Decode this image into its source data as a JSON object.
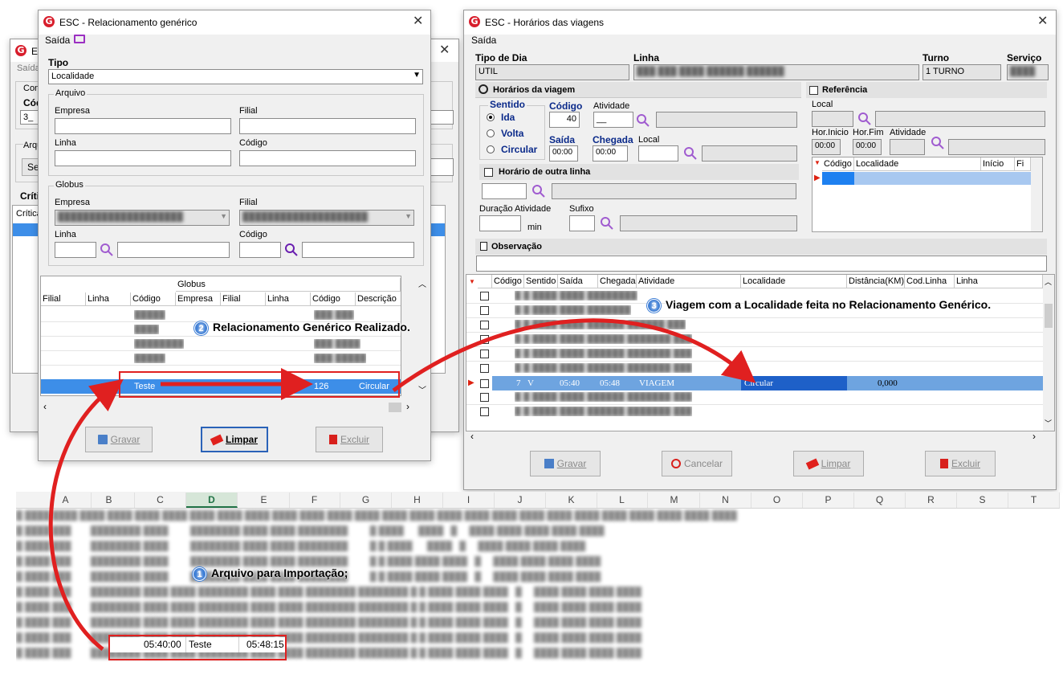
{
  "back_window": {
    "title_partial": "ES",
    "menu_partial": "Saída",
    "labels": [
      "Con",
      "Cód",
      "Arqu",
      "Crític"
    ],
    "code_value": "3_",
    "button_partial": "Se",
    "grid_header": "Crítica"
  },
  "rel_window": {
    "title": "ESC - Relacionamento genérico",
    "menu": "Saída",
    "tipo_label": "Tipo",
    "tipo_value": "Localidade",
    "arquivo": {
      "group_label": "Arquivo",
      "empresa_label": "Empresa",
      "filial_label": "Filial",
      "linha_label": "Linha",
      "codigo_label": "Código"
    },
    "globus": {
      "group_label": "Globus",
      "empresa_label": "Empresa",
      "filial_label": "Filial",
      "linha_label": "Linha",
      "codigo_label": "Código"
    },
    "grid": {
      "group_header": "Globus",
      "columns": [
        "Filial",
        "Linha",
        "Código",
        "Empresa",
        "Filial",
        "Linha",
        "Código",
        "Descrição"
      ],
      "selected_row": {
        "codigo": "Teste",
        "codigo_globus": "126",
        "descricao": "Circular"
      }
    },
    "buttons": {
      "gravar": "Gravar",
      "limpar": "Limpar",
      "excluir": "Excluir"
    }
  },
  "hor_window": {
    "title": "ESC - Horários das viagens",
    "menu": "Saída",
    "tipo_dia_label": "Tipo de Dia",
    "tipo_dia_value": "UTIL",
    "linha_label": "Linha",
    "turno_label": "Turno",
    "turno_value": "1 TURNO",
    "servico_label": "Serviço",
    "horarios_panel": "Horários da viagem",
    "sentido_label": "Sentido",
    "sentido_options": [
      "Ida",
      "Volta",
      "Circular"
    ],
    "codigo_label": "Código",
    "codigo_value": "40",
    "atividade_label": "Atividade",
    "atividade_value": "__",
    "saida_label": "Saída",
    "saida_value": "00:00",
    "chegada_label": "Chegada",
    "chegada_value": "00:00",
    "local_label": "Local",
    "horario_outra_linha": "Horário de outra linha",
    "duracao_label": "Duração Atividade",
    "min_label": "min",
    "sufixo_label": "Sufixo",
    "referencia_label": "Referência",
    "ref_local_label": "Local",
    "hor_inicio_label": "Hor.Inicio",
    "hor_inicio_value": "00:00",
    "hor_fim_label": "Hor.Fim",
    "hor_fim_value": "00:00",
    "ref_atividade_label": "Atividade",
    "ref_grid_columns": [
      "Código",
      "Localidade",
      "Início",
      "Fi"
    ],
    "observacao_label": "Observação",
    "grid_columns": [
      "Código",
      "Sentido",
      "Saída",
      "Chegada",
      "Atividade",
      "Localidade",
      "Distância(KM)",
      "Cod.Linha",
      "Linha"
    ],
    "selected_row": {
      "codigo": "7",
      "sentido": "V",
      "saida": "05:40",
      "chegada": "05:48",
      "atividade": "VIAGEM",
      "localidade": "Circular",
      "distancia": "0,000"
    },
    "buttons": {
      "gravar": "Gravar",
      "cancelar": "Cancelar",
      "limpar": "Limpar",
      "excluir": "Excluir"
    }
  },
  "spreadsheet": {
    "columns": [
      "A",
      "B",
      "C",
      "D",
      "E",
      "F",
      "G",
      "H",
      "I",
      "J",
      "K",
      "L",
      "M",
      "N",
      "O",
      "P",
      "Q",
      "R",
      "S",
      "T"
    ],
    "highlight_row": {
      "c": "05:40:00",
      "d": "Teste",
      "e": "05:48:15"
    }
  },
  "callouts": {
    "one": {
      "num": "1",
      "text": "Arquivo para Importação;"
    },
    "two": {
      "num": "2",
      "text": "Relacionamento Genérico Realizado."
    },
    "three": {
      "num": "3",
      "text": "Viagem com a Localidade feita no Relacionamento Genérico."
    }
  },
  "colors": {
    "accent_red": "#e02020",
    "selection_blue": "#3d8ee8",
    "logo_red": "#d81e2c",
    "search_purple": "#7a2ab8"
  }
}
